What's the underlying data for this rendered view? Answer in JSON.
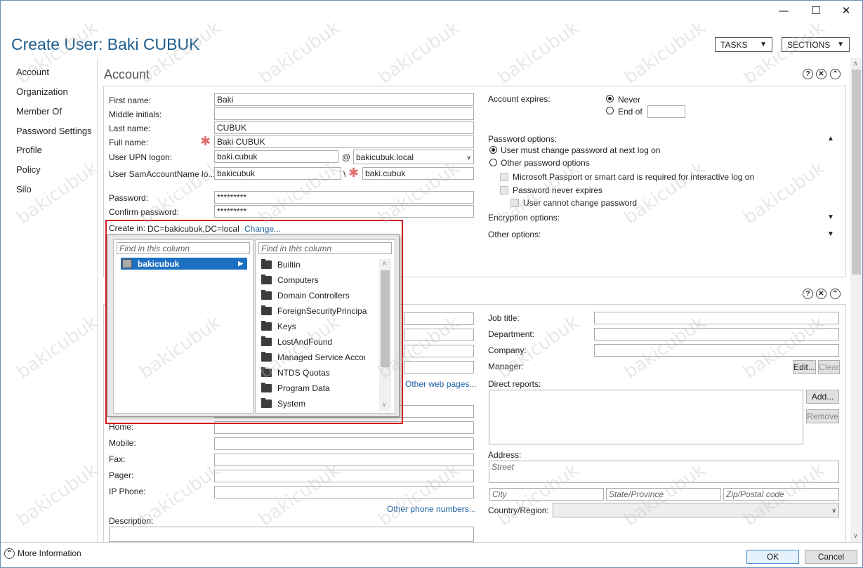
{
  "window": {
    "title": "Create User: Baki CUBUK",
    "tasks": "TASKS",
    "sections": "SECTIONS",
    "min": "—",
    "max": "☐",
    "close": "✕"
  },
  "nav": [
    "Account",
    "Organization",
    "Member Of",
    "Password Settings",
    "Profile",
    "Policy",
    "Silo"
  ],
  "account": {
    "heading": "Account",
    "first_name_label": "First name:",
    "first_name": "Baki",
    "middle_label": "Middle initials:",
    "middle": "",
    "last_name_label": "Last name:",
    "last_name": "CUBUK",
    "full_name_label": "Full name:",
    "full_name": "Baki CUBUK",
    "upn_label": "User UPN logon:",
    "upn": "baki.cubuk",
    "at": "@",
    "upn_domain": "bakicubuk.local",
    "sam_label": "User SamAccountName lo...",
    "sam_domain": "bakicubuk",
    "backslash": "\\",
    "sam": "baki.cubuk",
    "password_label": "Password:",
    "password": "*********",
    "confirm_label": "Confirm password:",
    "confirm": "*********",
    "create_in_label": "Create in:",
    "create_in": "DC=bakicubuk,DC=local",
    "change": "Change...",
    "expires_label": "Account expires:",
    "never": "Never",
    "end_of": "End of",
    "pwd_options": "Password options:",
    "must_change": "User must change password at next log on",
    "other_pwd": "Other password options",
    "passport": "Microsoft Passport or smart card is required for interactive log on",
    "never_expires": "Password never expires",
    "cannot_change": "User cannot change password",
    "encryption": "Encryption options:",
    "other_options": "Other options:"
  },
  "popup": {
    "find1": "Find in this column",
    "find2": "Find in this column",
    "root": "bakicubuk",
    "items": [
      "Builtin",
      "Computers",
      "Domain Controllers",
      "ForeignSecurityPrincipa",
      "Keys",
      "LostAndFound",
      "Managed Service Accou",
      "NTDS Quotas",
      "Program Data",
      "System"
    ]
  },
  "org": {
    "other_web": "Other web pages...",
    "home_label": "Home:",
    "mobile_label": "Mobile:",
    "fax_label": "Fax:",
    "pager_label": "Pager:",
    "ip_phone_label": "IP Phone:",
    "other_phone": "Other phone numbers...",
    "description_label": "Description:",
    "job_title_label": "Job title:",
    "department_label": "Department:",
    "company_label": "Company:",
    "manager_label": "Manager:",
    "edit": "Edit...",
    "clear": "Clear",
    "direct_reports_label": "Direct reports:",
    "add": "Add...",
    "remove": "Remove",
    "address_label": "Address:",
    "street_ph": "Street",
    "city_ph": "City",
    "state_ph": "State/Province",
    "zip_ph": "Zip/Postal code",
    "country_label": "Country/Region:"
  },
  "footer": {
    "more_info": "More Information",
    "ok": "OK",
    "cancel": "Cancel"
  },
  "watermark": "bakicubuk"
}
